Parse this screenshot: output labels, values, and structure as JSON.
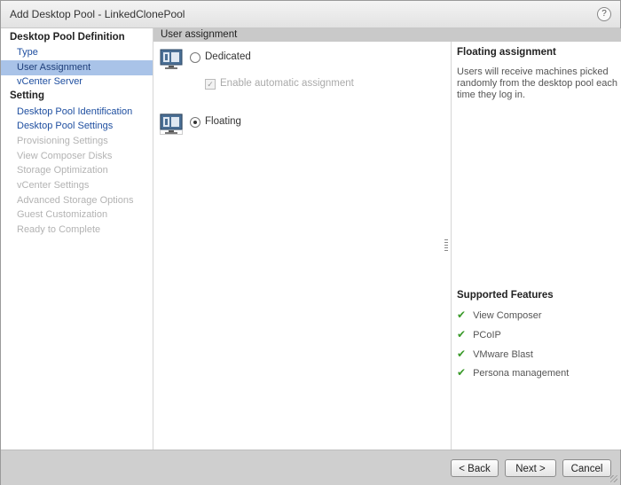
{
  "window": {
    "title": "Add Desktop Pool - LinkedClonePool",
    "help_label": "?"
  },
  "nav": {
    "section1": "Desktop Pool Definition",
    "section1_items": [
      {
        "label": "Type",
        "state": "link"
      },
      {
        "label": "User Assignment",
        "state": "selected"
      },
      {
        "label": "vCenter Server",
        "state": "link"
      }
    ],
    "section2": "Setting",
    "section2_items": [
      {
        "label": "Desktop Pool Identification",
        "state": "link"
      },
      {
        "label": "Desktop Pool Settings",
        "state": "link"
      },
      {
        "label": "Provisioning Settings",
        "state": "disabled"
      },
      {
        "label": "View Composer Disks",
        "state": "disabled"
      },
      {
        "label": "Storage Optimization",
        "state": "disabled"
      },
      {
        "label": "vCenter Settings",
        "state": "disabled"
      },
      {
        "label": "Advanced Storage Options",
        "state": "disabled"
      },
      {
        "label": "Guest Customization",
        "state": "disabled"
      },
      {
        "label": "Ready to Complete",
        "state": "disabled"
      }
    ]
  },
  "main": {
    "header": "User assignment",
    "options": {
      "dedicated": {
        "label": "Dedicated",
        "selected": false
      },
      "auto_assignment": {
        "label": "Enable automatic assignment",
        "checked": true,
        "enabled": false
      },
      "floating": {
        "label": "Floating",
        "selected": true
      }
    }
  },
  "side": {
    "title": "Floating assignment",
    "description": "Users will receive machines picked randomly from the desktop pool each time they log in.",
    "features_title": "Supported Features",
    "features": [
      "View Composer",
      "PCoIP",
      "VMware Blast",
      "Persona management"
    ]
  },
  "footer": {
    "back_label": "< Back",
    "next_label": "Next >",
    "cancel_label": "Cancel"
  },
  "colors": {
    "link": "#1f4fa0",
    "selected_bg": "#a9c3e8",
    "disabled": "#b3b3b3",
    "check_green": "#3a9a2a",
    "header_bg": "#c9c9c9",
    "footer_bg": "#cfcfcf"
  },
  "icons": {
    "pool_monitor": "monitor-icon",
    "feature_check": "checkmark-icon",
    "help": "help-icon"
  }
}
